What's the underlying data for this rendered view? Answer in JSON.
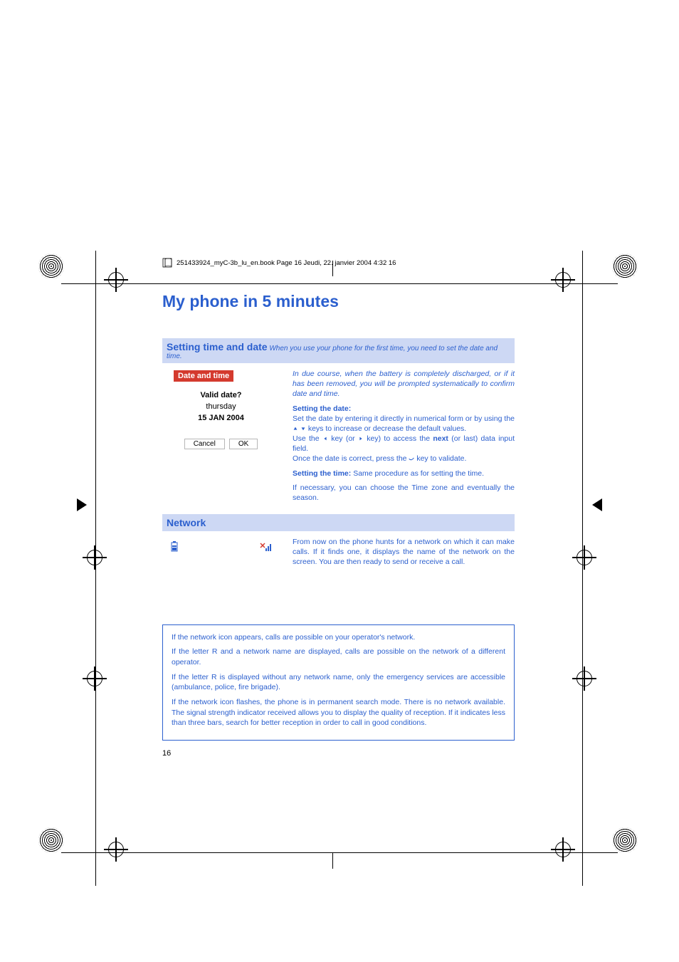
{
  "header": "251433924_myC-3b_lu_en.book  Page 16  Jeudi, 22. janvier 2004  4:32 16",
  "title": "My phone in 5 minutes",
  "section1": {
    "lead": "Setting time and date",
    "tail": "When you use your phone for the first time, you need to set the date and time."
  },
  "phoneScreen": {
    "barLabel": "Date and time",
    "line1": "Valid date?",
    "line2": "thursday",
    "line3": "15 JAN 2004",
    "btnCancel": "Cancel",
    "btnOk": "OK"
  },
  "body1": {
    "p1": "In due course, when the battery is completely discharged, or if it has been removed, you will be prompted systematically to confirm date and time.",
    "h1": "Setting the date:",
    "p2a": "Set the date by entering it directly in numerical form or by using the ",
    "p2b": " keys to increase or decrease the default values.",
    "p3a": "Use the ",
    "p3b": " key (or ",
    "p3c": " key) to access the ",
    "p3next": "next",
    "p3d": " (or last) data input field.",
    "p4a": "Once the date is correct, press the ",
    "p4b": " key to validate.",
    "h2": "Setting the time:",
    "p5": " Same procedure as for setting the time.",
    "p6": "If necessary, you can choose the Time zone and eventually the season."
  },
  "section2": "Network",
  "networkText": "From now on the phone hunts for a network on which it can make calls. If it finds one, it displays the name of the network on the screen. You are then ready to send or receive a call.",
  "infoBox": {
    "p1": "If the network icon appears, calls are possible on your operator's network.",
    "p2": "If the letter R and a network name are displayed, calls are possible on the network of a different operator.",
    "p3": "If the letter R is displayed without any network name, only the emergency services are accessible (ambulance, police, fire brigade).",
    "p4": "If the network icon flashes, the phone is in permanent search mode. There is no network available. The signal strength indicator received allows you to display the quality of reception. If it indicates less than three bars, search for better reception in order to call in good conditions."
  },
  "pageNumber": "16"
}
